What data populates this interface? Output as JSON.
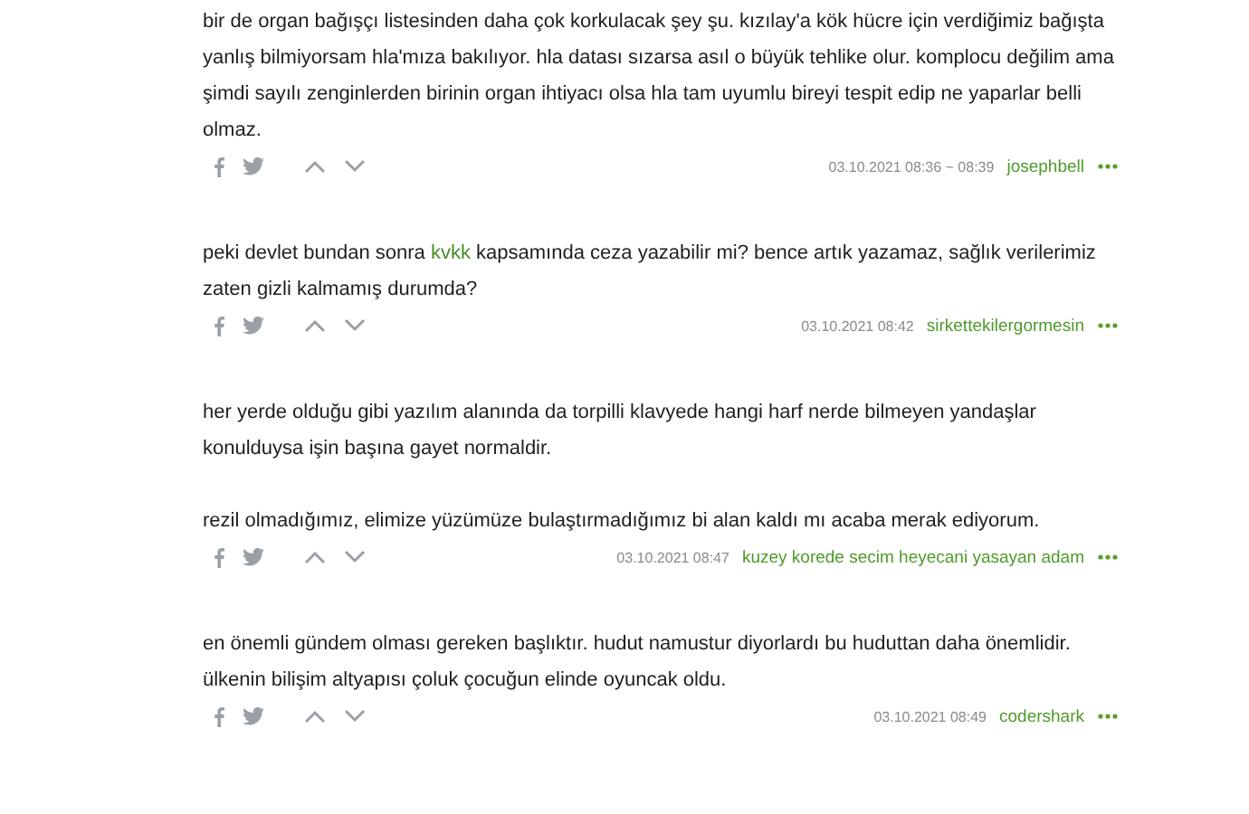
{
  "entries": [
    {
      "paragraphs": [
        [
          [
            {
              "kind": "text",
              "text": "bir de organ bağışçı listesinden daha çok korkulacak şey şu. kızılay'a kök hücre için verdiğimiz bağışta yanlış bilmiyorsam hla'mıza bakılıyor. hla datası sızarsa asıl o büyük tehlike olur. komplocu değilim ama şimdi sayılı zenginlerden birinin organ ihtiyacı olsa hla tam uyumlu bireyi tespit edip ne yaparlar belli olmaz."
            }
          ]
        ]
      ],
      "date": "03.10.2021 08:36 ~ 08:39",
      "author": "josephbell"
    },
    {
      "paragraphs": [
        [
          [
            {
              "kind": "text",
              "text": "peki devlet bundan sonra "
            },
            {
              "kind": "link",
              "text": "kvkk"
            },
            {
              "kind": "text",
              "text": " kapsamında ceza yazabilir mi? bence artık yazamaz, sağlık verilerimiz zaten gizli kalmamış durumda?"
            }
          ]
        ]
      ],
      "date": "03.10.2021 08:42",
      "author": "sirkettekilergormesin"
    },
    {
      "paragraphs": [
        [
          [
            {
              "kind": "text",
              "text": "her yerde olduğu gibi yazılım alanında da torpilli klavyede hangi harf nerde bilmeyen yandaşlar konulduysa işin başına gayet normaldir."
            }
          ]
        ],
        [
          [
            {
              "kind": "text",
              "text": "rezil olmadığımız, elimize yüzümüze bulaştırmadığımız bi alan kaldı mı acaba merak ediyorum."
            }
          ]
        ]
      ],
      "date": "03.10.2021 08:47",
      "author": "kuzey korede secim heyecani yasayan adam"
    },
    {
      "paragraphs": [
        [
          [
            {
              "kind": "text",
              "text": "en önemli gündem olması gereken başlıktır. hudut namustur diyorlardı bu huduttan daha önemlidir."
            }
          ],
          [
            {
              "kind": "text",
              "text": "ülkenin bilişim altyapısı çoluk çocuğun elinde oyuncak oldu."
            }
          ]
        ]
      ],
      "date": "03.10.2021 08:49",
      "author": "codershark"
    }
  ]
}
